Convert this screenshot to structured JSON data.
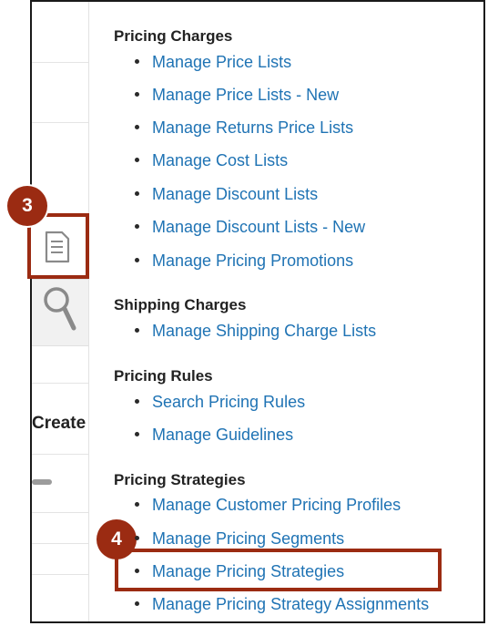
{
  "left_panel": {
    "create_label": "Create"
  },
  "callouts": {
    "step3": "3",
    "step4": "4"
  },
  "icons": {
    "page": "document-icon",
    "search": "search-icon"
  },
  "colors": {
    "link": "#1f73b4",
    "callout": "#9b2b12"
  },
  "sections": {
    "pricing_charges": {
      "title": "Pricing Charges",
      "links": [
        "Manage Price Lists",
        "Manage Price Lists - New",
        "Manage Returns Price Lists",
        "Manage Cost Lists",
        "Manage Discount Lists",
        "Manage Discount Lists - New",
        "Manage Pricing Promotions"
      ]
    },
    "shipping_charges": {
      "title": "Shipping Charges",
      "links": [
        "Manage Shipping Charge Lists"
      ]
    },
    "pricing_rules": {
      "title": "Pricing Rules",
      "links": [
        "Search Pricing Rules",
        "Manage Guidelines"
      ]
    },
    "pricing_strategies": {
      "title": "Pricing Strategies",
      "links": [
        "Manage Customer Pricing Profiles",
        "Manage Pricing Segments",
        "Manage Pricing Strategies",
        "Manage Pricing Strategy Assignments"
      ]
    }
  }
}
